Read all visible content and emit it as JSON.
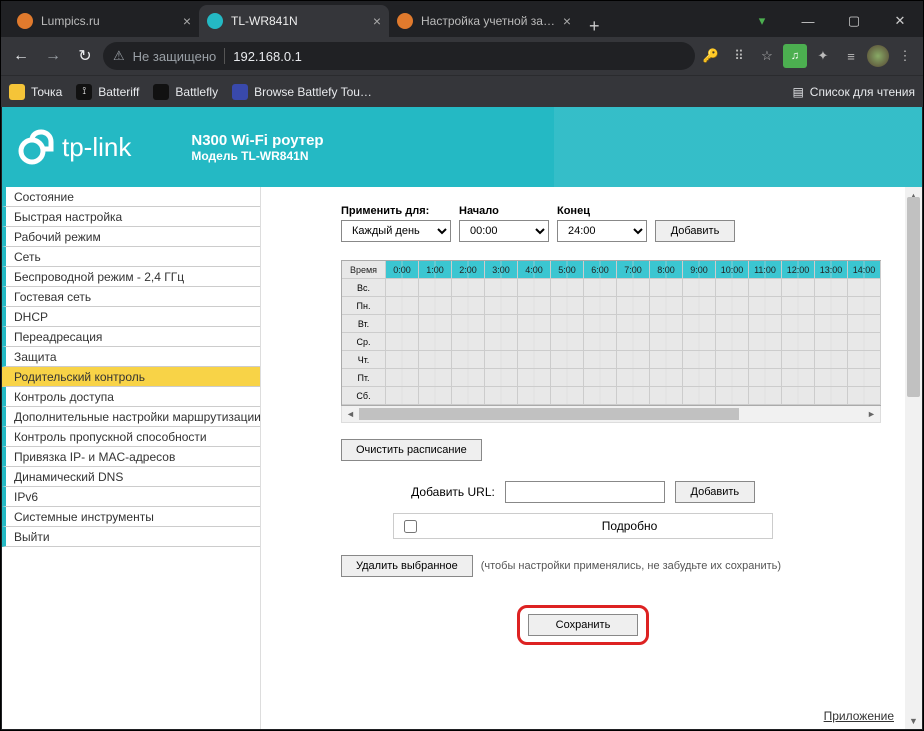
{
  "browser": {
    "tabs": [
      {
        "title": "Lumpics.ru",
        "favcolor": "#e07a2d",
        "active": false
      },
      {
        "title": "TL-WR841N",
        "favcolor": "#24b9c4",
        "active": true
      },
      {
        "title": "Настройка учетной запис",
        "favcolor": "#e07a2d",
        "active": false
      }
    ],
    "newtab": "+",
    "win": {
      "min": "—",
      "max": "▢",
      "close": "✕"
    },
    "nav": {
      "back": "←",
      "fwd": "→",
      "reload": "↻"
    },
    "security_label": "Не защищено",
    "url": "192.168.0.1",
    "right_icons": {
      "key": "🔑",
      "translate": "⠿",
      "star": "☆"
    },
    "exts": {
      "green": "♫",
      "puzzle": "✦",
      "list": "≡"
    },
    "menu": "⋮",
    "bookmarks": [
      {
        "label": "Точка",
        "color": "#f5c438"
      },
      {
        "label": "Batteriff",
        "color": "#222"
      },
      {
        "label": "Battlefly",
        "color": "#222"
      },
      {
        "label": "Browse Battlefy Tou…",
        "color": "#3949ab"
      }
    ],
    "reading_list": {
      "icon": "▤",
      "label": "Список для чтения"
    }
  },
  "router": {
    "brand": "tp-link",
    "product_line1": "N300 Wi-Fi роутер",
    "product_line2": "Модель TL-WR841N",
    "menu": [
      "Состояние",
      "Быстрая настройка",
      "Рабочий режим",
      "Сеть",
      "Беспроводной режим - 2,4 ГГц",
      "Гостевая сеть",
      "DHCP",
      "Переадресация",
      "Защита",
      "Родительский контроль",
      "Контроль доступа",
      "Дополнительные настройки маршрутизации",
      "Контроль пропускной способности",
      "Привязка IP- и MAC-адресов",
      "Динамический DNS",
      "IPv6",
      "Системные инструменты",
      "Выйти"
    ],
    "menu_active_index": 9,
    "schedule": {
      "apply_label": "Применить для:",
      "apply_value": "Каждый день",
      "start_label": "Начало",
      "start_value": "00:00",
      "end_label": "Конец",
      "end_value": "24:00",
      "add_btn": "Добавить",
      "time_header": "Время",
      "hours": [
        "0:00",
        "1:00",
        "2:00",
        "3:00",
        "4:00",
        "5:00",
        "6:00",
        "7:00",
        "8:00",
        "9:00",
        "10:00",
        "11:00",
        "12:00",
        "13:00",
        "14:00"
      ],
      "days": [
        "Вс.",
        "Пн.",
        "Вт.",
        "Ср.",
        "Чт.",
        "Пт.",
        "Сб."
      ],
      "clear_btn": "Очистить расписание"
    },
    "url_section": {
      "add_url_label": "Добавить URL:",
      "add_btn": "Добавить",
      "detail_label": "Подробно",
      "delete_btn": "Удалить выбранное",
      "note": "(чтобы настройки применялись, не забудьте их сохранить)"
    },
    "save_btn": "Сохранить",
    "footer_link": "Приложение"
  }
}
